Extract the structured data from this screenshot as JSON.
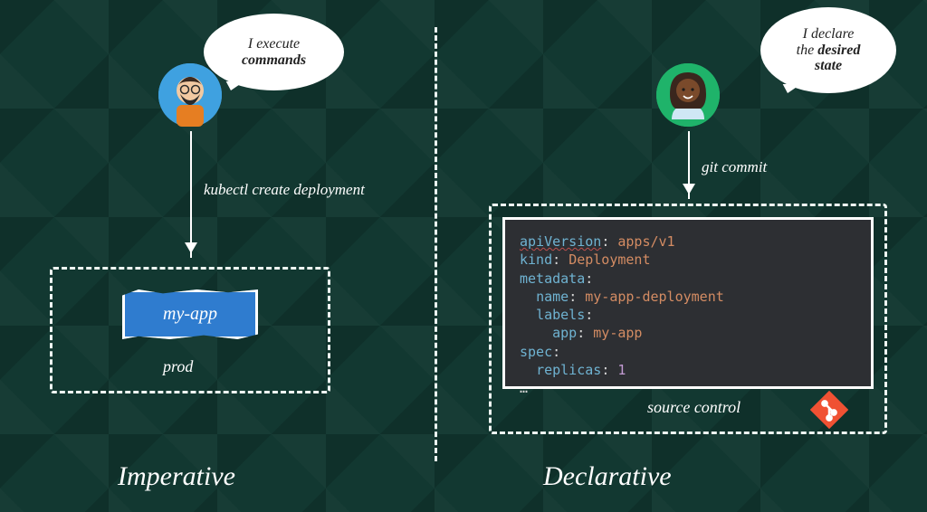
{
  "titles": {
    "left": "Imperative",
    "right": "Declarative"
  },
  "bubbles": {
    "left": {
      "line1": "I execute",
      "line2_bold": "commands"
    },
    "right": {
      "line1": "I declare",
      "line2a": "the ",
      "line2b_bold": "desired",
      "line3_bold": "state"
    }
  },
  "arrows": {
    "left_label": "kubectl create deployment",
    "right_label": "git commit"
  },
  "boxes": {
    "prod_caption": "prod",
    "src_caption": "source control",
    "app_name": "my-app"
  },
  "code": {
    "l1_key": "apiVersion",
    "l1_val": "apps/v1",
    "l2_key": "kind",
    "l2_val": "Deployment",
    "l3_key": "metadata",
    "l4_key": "name",
    "l4_val": "my-app-deployment",
    "l5_key": "labels",
    "l6_key": "app",
    "l6_val": "my-app",
    "l7_key": "spec",
    "l8_key": "replicas",
    "l8_val": "1",
    "l9": "…"
  },
  "icons": {
    "git": "git-icon",
    "avatars": {
      "left": "man-avatar",
      "right": "woman-avatar"
    }
  },
  "colors": {
    "background": "#123831",
    "accent_blue": "#2f7ccf",
    "code_bg": "#2d2f33",
    "git_orange": "#f05133"
  }
}
